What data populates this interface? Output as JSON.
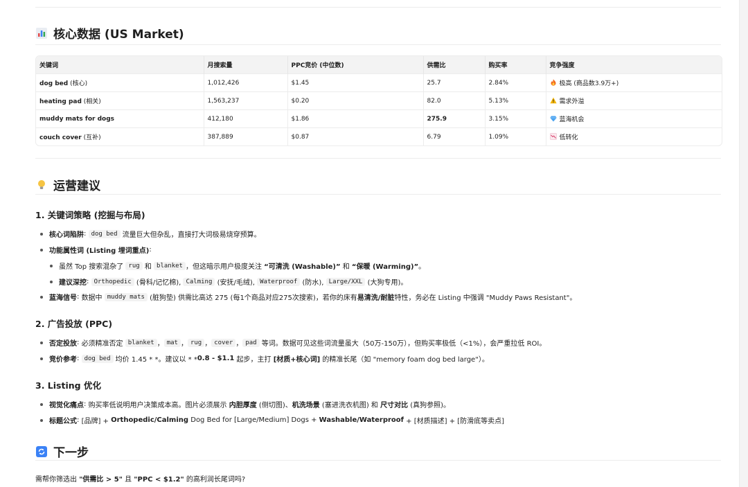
{
  "sections": {
    "core": {
      "icon": "bar-chart-icon",
      "title": "核心数据 (US Market)"
    },
    "ops": {
      "icon": "lightbulb-icon",
      "title": "运营建议"
    },
    "next": {
      "icon": "refresh-icon",
      "title": "下一步"
    }
  },
  "table": {
    "headers": [
      "关键词",
      "月搜索量",
      "PPC竞价 (中位数)",
      "供需比",
      "购买率",
      "竞争强度"
    ],
    "rows": [
      {
        "kw": "dog bed",
        "kw_note": " (核心)",
        "volume": "1,012,426",
        "ppc": "$1.45",
        "ratio": "25.7",
        "ratio_bold": false,
        "cr": "2.84%",
        "comp_icon": "fire-icon",
        "comp": "极高 (商品数3.9万+)"
      },
      {
        "kw": "heating pad",
        "kw_note": " (相关)",
        "volume": "1,563,237",
        "ppc": "$0.20",
        "ratio": "82.0",
        "ratio_bold": false,
        "cr": "5.13%",
        "comp_icon": "warning-icon",
        "comp": "需求外溢"
      },
      {
        "kw": "muddy mats for dogs",
        "kw_note": "",
        "volume": "412,180",
        "ppc": "$1.86",
        "ratio": "275.9",
        "ratio_bold": true,
        "cr": "3.15%",
        "comp_icon": "diamond-icon",
        "comp": "蓝海机会"
      },
      {
        "kw": "couch cover",
        "kw_note": " (互补)",
        "volume": "387,889",
        "ppc": "$0.87",
        "ratio": "6.79",
        "ratio_bold": false,
        "cr": "1.09%",
        "comp_icon": "chart-down-icon",
        "comp": "低转化"
      }
    ]
  },
  "s1": {
    "title": "1. 关键词策略 (挖掘与布局)",
    "b1": {
      "label": "核心词陷阱",
      "colon": ": ",
      "code": "dog bed",
      "text": " 流量巨大但杂乱，直接打大词极易烧穿预算。"
    },
    "b2": {
      "label": "功能属性词 (Listing 埋词重点)",
      "colon": ":"
    },
    "b2a": {
      "t1": "虽然 Top 搜索混杂了 ",
      "c1": "rug",
      "t2": " 和 ",
      "c2": "blanket",
      "t3": "，但这暗示用户极度关注 ",
      "bold1": "“可清洗 (Washable)”",
      "t4": " 和 ",
      "bold2": "“保暖 (Warming)”",
      "t5": "。"
    },
    "b2b": {
      "label": "建议深挖",
      "colon": ": ",
      "c1": "Orthopedic",
      "t1": " (骨科/记忆棉), ",
      "c2": "Calming",
      "t2": " (安抚/毛绒), ",
      "c3": "Waterproof",
      "t3": " (防水), ",
      "c4": "Large/XXL",
      "t4": " (大狗专用)。"
    },
    "b3": {
      "label": "蓝海信号",
      "colon": ": ",
      "t1": "数据中 ",
      "code": "muddy mats",
      "t2": " (脏狗垫) 供需比高达 275 (每1个商品对应275次搜索)，若你的床有",
      "bold": "易清洗/耐脏",
      "t3": "特性，务必在 Listing 中强调 \"Muddy Paws Resistant\"。"
    }
  },
  "s2": {
    "title": "2. 广告投放 (PPC)",
    "b1": {
      "label": "否定投放",
      "colon": ": ",
      "t1": "必须精准否定 ",
      "codes": [
        "blanket",
        "mat",
        "rug",
        "cover",
        "pad"
      ],
      "sep": "，",
      "t2": " 等词。数据可见这些词流量虽大（50万-150万），但购买率极低（<1%），会严重拉低 ROI。"
    },
    "b2": {
      "label": "竞价参考",
      "colon": ": ",
      "code": "dog bed",
      "t1": " 均价 1.45 * *。建议以 * *",
      "bold1": "0.8 - $1.1",
      "t2": " 起步，主打 ",
      "bold2": "[材质+核心词]",
      "t3": " 的精准长尾（如 \"memory foam dog bed large\"）。"
    }
  },
  "s3": {
    "title": "3. Listing 优化",
    "b1": {
      "label": "视觉化痛点",
      "colon": ": ",
      "t1": "购买率低说明用户决策成本高。图片必须展示 ",
      "bold1": "内胆厚度",
      "t2": " (侧切图)、",
      "bold2": "机洗场景",
      "t3": " (塞进洗衣机图) 和 ",
      "bold3": "尺寸对比",
      "t4": " (真狗参照)。"
    },
    "b2": {
      "label": "标题公式",
      "colon": ": ",
      "t1": "[品牌] + ",
      "bold1": "Orthopedic/Calming",
      "t2": " Dog Bed for [Large/Medium] Dogs + ",
      "bold2": "Washable/Waterproof",
      "t3": " + [材质描述] + [防滑底等卖点]"
    }
  },
  "next": {
    "t1": "需帮你筛选出 ",
    "bold1": "\"供需比 > 5\"",
    "t2": " 且 ",
    "bold2": "\"PPC < $1.2\"",
    "t3": " 的高利润长尾词吗?"
  },
  "colors": {
    "accent_icon_blue": "#3b82f6",
    "border": "#ececec",
    "header_bg": "#f3f3f3"
  }
}
